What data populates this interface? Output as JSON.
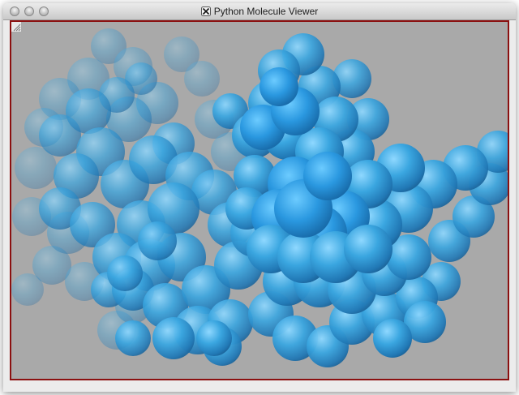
{
  "window": {
    "title": "Python Molecule Viewer",
    "title_icon": "x11-icon"
  },
  "viewport": {
    "background_color": "#a9a9a9",
    "frame_color": "#8b1010",
    "atom_color": "#3aa6e0",
    "content": "space-filling molecule rendering of blue spheres"
  }
}
